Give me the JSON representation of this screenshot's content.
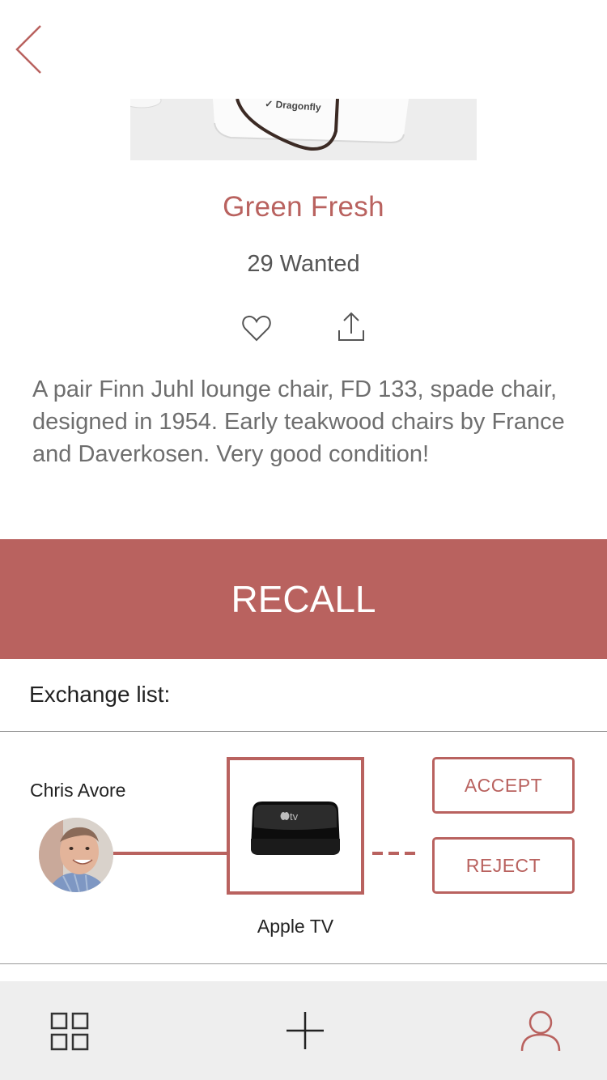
{
  "nav": {
    "back_icon": "chevron-left-icon"
  },
  "product": {
    "title": "Green Fresh",
    "wanted": "29 Wanted",
    "image_brand_text": "Dragonfly",
    "description": "A pair Finn Juhl lounge chair, FD 133, spade chair, designed in 1954. Early teakwood chairs by France and Daverkosen. Very good condition!"
  },
  "actions": {
    "like_icon": "heart-icon",
    "share_icon": "share-icon"
  },
  "recall_button": "RECALL",
  "exchange": {
    "heading": "Exchange list:",
    "offers": [
      {
        "user_name": "Chris Avore",
        "item_label": "Apple TV",
        "item_logo_text": "tv",
        "accept_label": "ACCEPT",
        "reject_label": "REJECT"
      }
    ]
  },
  "tabbar": {
    "items": [
      "grid-icon",
      "plus-icon",
      "user-icon"
    ],
    "active": "user-icon"
  },
  "colors": {
    "accent": "#b9625f",
    "text_dark": "#222222",
    "text_gray": "#6e6e6e",
    "tabbar_bg": "#eeeeee"
  }
}
